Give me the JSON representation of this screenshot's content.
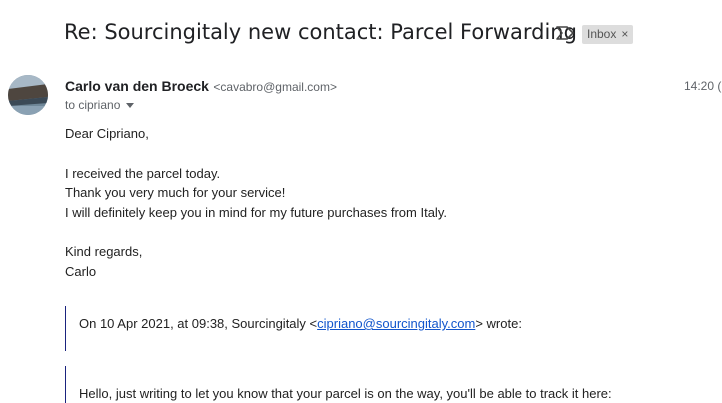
{
  "email": {
    "subject": "Re: Sourcingitaly new contact: Parcel Forwarding",
    "label": "Inbox",
    "label_close": "×",
    "sender": {
      "name": "Carlo van den Broeck",
      "email": "<cavabro@gmail.com>",
      "time": "14:20 ("
    },
    "recipient": "to cipriano",
    "body": [
      "Dear Cipriano,",
      "I received the parcel today.",
      "Thank you very much for your service!",
      "I will definitely keep you in mind for my future purchases from Italy.",
      "Kind regards,",
      "Carlo"
    ],
    "quote": {
      "header_prefix": "On 10 Apr 2021, at 09:38, Sourcingitaly <",
      "header_link": "cipriano@sourcingitaly.com",
      "header_suffix": "> wrote:",
      "text": "Hello, just writing to let you know that your parcel is on the way, you'll be able to track it here:"
    }
  },
  "icons": {
    "important": "important-marker-icon",
    "recipient_details": "chevron-down-icon"
  },
  "colors": {
    "link": "#1155cc",
    "quote_bar": "#1a237e",
    "badge_bg": "#dddddd"
  }
}
